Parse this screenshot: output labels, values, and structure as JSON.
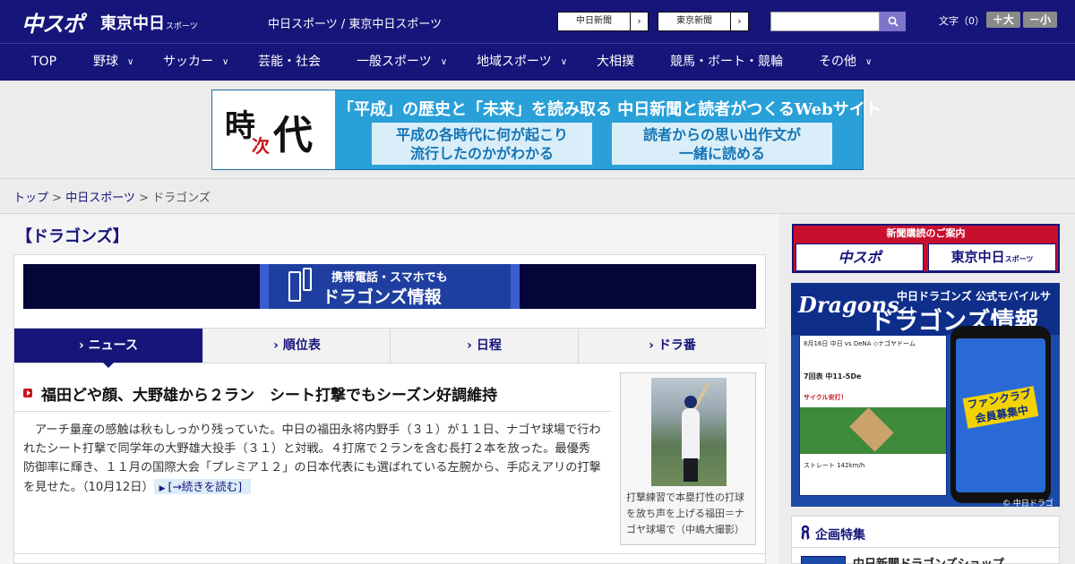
{
  "header": {
    "logo_main": "中スポ",
    "logo_tokyo": "東京中日",
    "logo_tokyo_sub": "スポーツ",
    "site_name": "中日スポーツ / 東京中日スポーツ",
    "btn_chunichi": "中日新聞",
    "btn_tokyo": "東京新聞",
    "search_placeholder": "",
    "text_size_label": "文字（0）",
    "size_up": "＋大",
    "size_down": "－小"
  },
  "nav": {
    "items": [
      {
        "label": "TOP"
      },
      {
        "label": "野球"
      },
      {
        "label": "サッカー"
      },
      {
        "label": "芸能・社会"
      },
      {
        "label": "一般スポーツ"
      },
      {
        "label": "地域スポーツ"
      },
      {
        "label": "大相撲"
      },
      {
        "label": "競馬・ボート・競輪"
      },
      {
        "label": "その他"
      }
    ]
  },
  "banner": {
    "logo_ji": "時",
    "logo_ji2": "次",
    "logo_dai": "代",
    "headline": "「平成」の歴史と「未来」を読み取る 中日新聞と読者がつくるWebサイト",
    "box1_line1": "平成の各時代に何が起こり",
    "box1_line2": "流行したのかがわかる",
    "box2_line1": "読者からの思い出作文が",
    "box2_line2": "一緒に読める"
  },
  "breadcrumb": {
    "top": "トップ",
    "sep": ">",
    "parent": "中日スポーツ",
    "current": "ドラゴンズ"
  },
  "section_title": "【ドラゴンズ】",
  "mobile_banner": {
    "line1": "携帯電話・スマホでも",
    "line2": "ドラゴンズ情報"
  },
  "tabs": [
    {
      "label": "› ニュース",
      "active": true
    },
    {
      "label": "› 順位表",
      "active": false
    },
    {
      "label": "› 日程",
      "active": false
    },
    {
      "label": "› ドラ番",
      "active": false
    }
  ],
  "article": {
    "title": "福田どや顔、大野雄から２ラン　シート打撃でもシーズン好調維持",
    "body": "アーチ量産の感触は秋もしっかり残っていた。中日の福田永将内野手（３１）が１１日、ナゴヤ球場で行われたシート打撃で同学年の大野雄大投手（３１）と対戦。４打席で２ランを含む長打２本を放った。最優秀防御率に輝き、１１月の国際大会「プレミア１２」の日本代表にも選ばれている左腕から、手応えアリの打撃を見せた。",
    "date": "（10月12日）",
    "more": "[→続きを読む]",
    "caption": "打撃練習で本塁打性の打球を放ち声を上げる福田＝ナゴヤ球場で（中嶋大撮影）"
  },
  "sidebar": {
    "subscribe_head": "新聞購読のご案内",
    "sub_logo1": "中スポ",
    "sub_logo2": "東京中日",
    "sub_logo2_sub": "スポーツ",
    "ad_word": "Dragons",
    "ad_line1": "中日ドラゴンズ 公式モバイルサイト",
    "ad_line2": "ドラゴンズ情報",
    "ad_badge": "ファンクラブ会員募集中",
    "ad_copy": "© 中日ドラゴンズ",
    "ad_score_row1": "8月16日 中日 vs DeNA ◇ナゴヤドーム",
    "ad_score_row2": "7回表 中11-5De",
    "ad_score_row3": "サイクル安打！",
    "ad_score_row4": "ストレート 142km/h",
    "kikaku_title": "企画特集",
    "kikaku_item": "中日新聞ドラゴンズショップ"
  },
  "colors": {
    "brand_navy": "#16157a",
    "accent_red": "#c7161e",
    "link_bg": "#dcecf8"
  }
}
